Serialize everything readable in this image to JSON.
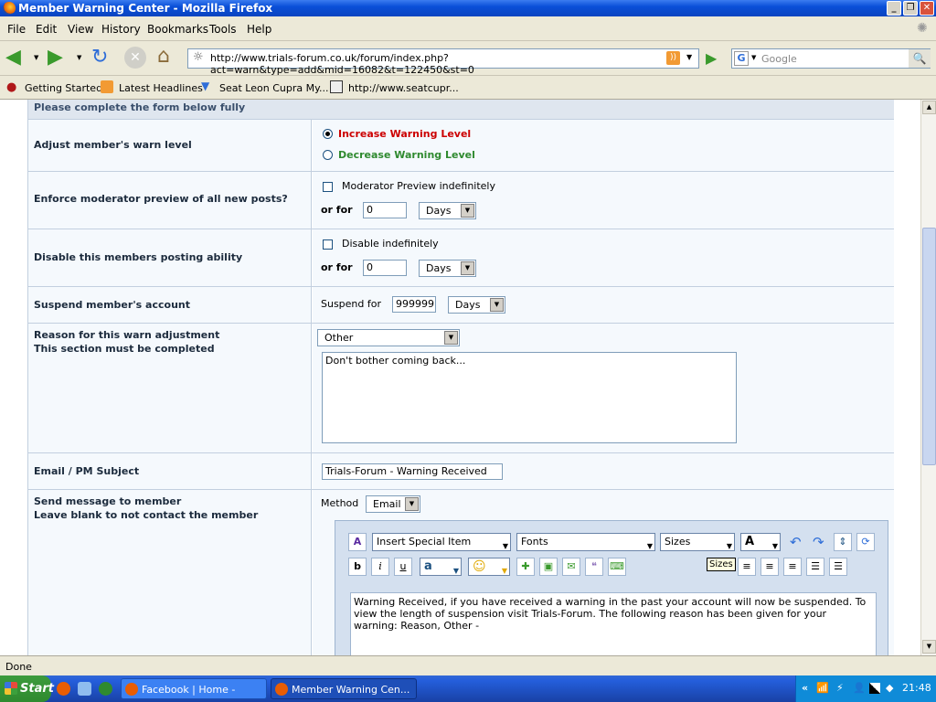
{
  "window": {
    "title": "Member Warning Center - Mozilla Firefox"
  },
  "menu": [
    "File",
    "Edit",
    "View",
    "History",
    "Bookmarks",
    "Tools",
    "Help"
  ],
  "nav": {
    "url": "http://www.trials-forum.co.uk/forum/index.php?act=warn&type=add&mid=16082&t=122450&st=0",
    "search_placeholder": "Google"
  },
  "bookmarks": [
    "Getting Started",
    "Latest Headlines",
    "Seat Leon Cupra My...",
    "http://www.seatcupr..."
  ],
  "form": {
    "header": "Please complete the form below fully",
    "warn_level": {
      "label": "Adjust member's warn level",
      "increase": "Increase Warning Level",
      "decrease": "Decrease Warning Level",
      "increase_color": "#cc0000",
      "decrease_color": "#2f8a2f"
    },
    "mod_preview": {
      "label": "Enforce moderator preview of all new posts?",
      "checkbox": "Moderator Preview indefinitely",
      "or_for": "or for",
      "value": "0",
      "unit": "Days"
    },
    "posting": {
      "label": "Disable this members posting ability",
      "checkbox": "Disable indefinitely",
      "or_for": "or for",
      "value": "0",
      "unit": "Days"
    },
    "suspend": {
      "label": "Suspend member's account",
      "suspend_for": "Suspend for",
      "value": "999999",
      "unit": "Days"
    },
    "reason": {
      "label_1": "Reason for this warn adjustment",
      "label_2": "This section must be completed",
      "selected": "Other",
      "text": "Don't bother coming back..."
    },
    "subject": {
      "label": "Email / PM Subject",
      "value": "Trials-Forum - Warning Received"
    },
    "message": {
      "label_1": "Send message to member",
      "label_2": "Leave blank to not contact the member",
      "method_label": "Method",
      "method": "Email",
      "editor": {
        "insert_special": "Insert Special Item",
        "fonts": "Fonts",
        "sizes": "Sizes",
        "tooltip": "Sizes",
        "text": "Warning Received, if you have received a warning in the past your account will now be suspended. To view the length of suspension visit Trials-Forum. The following reason has been given for your warning: Reason, Other -"
      }
    }
  },
  "status": "Done",
  "taskbar": {
    "start": "Start",
    "tasks": [
      "Facebook | Home - Mozill...",
      "Member Warning Cen..."
    ],
    "clock": "21:48"
  }
}
